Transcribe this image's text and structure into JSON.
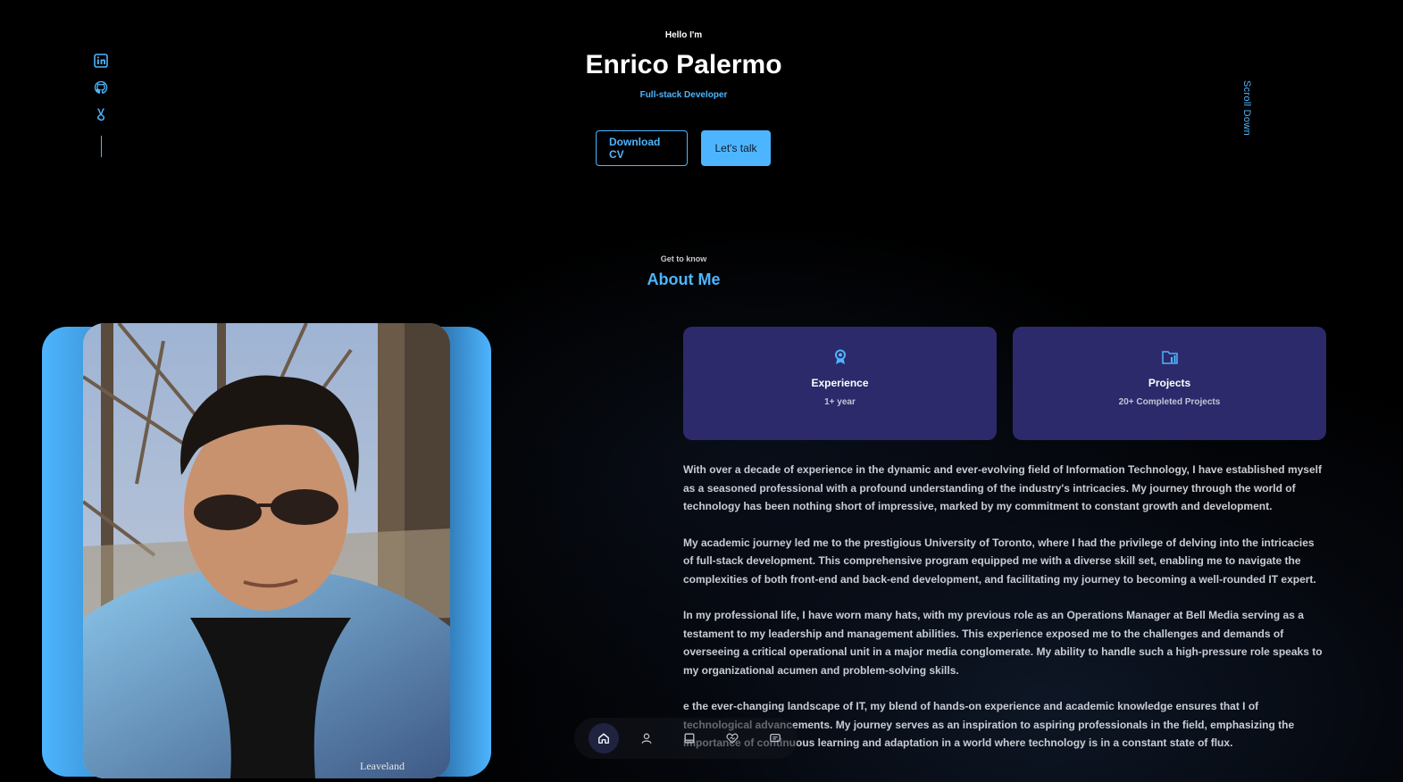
{
  "header": {
    "greeting": "Hello I'm",
    "name": "Enrico Palermo",
    "role": "Full-stack Developer",
    "download_cv": "Download CV",
    "lets_talk": "Let's talk",
    "scroll_down": "Scroll Down"
  },
  "socials": [
    {
      "icon": "linkedin-icon"
    },
    {
      "icon": "github-icon"
    },
    {
      "icon": "social-icon"
    }
  ],
  "about": {
    "kicker": "Get to know",
    "title": "About Me",
    "cards": [
      {
        "icon": "award-icon",
        "title": "Experience",
        "subtitle": "1+ year"
      },
      {
        "icon": "folder-icon",
        "title": "Projects",
        "subtitle": "20+ Completed Projects"
      }
    ],
    "paragraphs": [
      "With over a decade of experience in the dynamic and ever-evolving field of Information Technology, I have established myself as a seasoned professional with a profound understanding of the industry's intricacies. My journey through the world of technology has been nothing short of impressive, marked by my commitment to constant growth and development.",
      "My academic journey led me to the prestigious University of Toronto, where I had the privilege of delving into the intricacies of full-stack development. This comprehensive program equipped me with a diverse skill set, enabling me to navigate the complexities of both front-end and back-end development, and facilitating my journey to becoming a well-rounded IT expert.",
      "In my professional life, I have worn many hats, with my previous role as an Operations Manager at Bell Media serving as a testament to my leadership and management abilities. This experience exposed me to the challenges and demands of overseeing a critical operational unit in a major media conglomerate. My ability to handle such a high-pressure role speaks to my organizational acumen and problem-solving skills.",
      "e the ever-changing landscape of IT, my blend of hands-on experience and academic knowledge ensures that I of technological advancements. My journey serves as an inspiration to aspiring professionals in the field, emphasizing the importance of continuous learning and adaptation in a world where technology is in a constant state of flux."
    ],
    "photo_text": "Leaveland"
  },
  "nav": [
    {
      "icon": "home-icon",
      "active": true
    },
    {
      "icon": "user-icon",
      "active": false
    },
    {
      "icon": "book-icon",
      "active": false
    },
    {
      "icon": "services-icon",
      "active": false
    },
    {
      "icon": "message-icon",
      "active": false
    }
  ],
  "colors": {
    "accent": "#4db5ff",
    "card_bg": "#2c2a6a",
    "background": "#000000"
  }
}
